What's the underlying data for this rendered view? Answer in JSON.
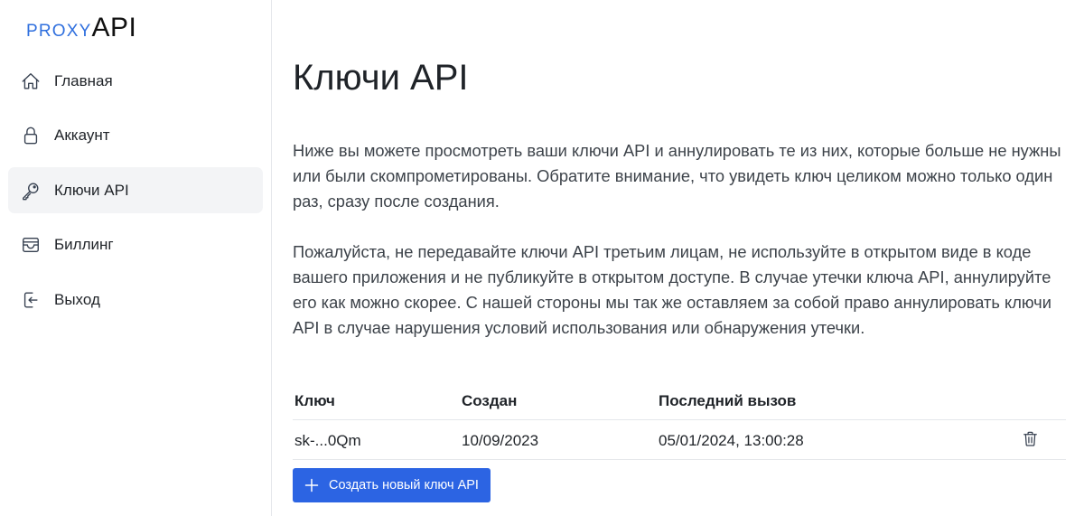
{
  "brand": {
    "logo_prefix": "PROXY",
    "logo_suffix": "API",
    "accent_color": "#2f6fde"
  },
  "sidebar": {
    "items": [
      {
        "label": "Главная",
        "icon": "home-icon",
        "active": false
      },
      {
        "label": "Аккаунт",
        "icon": "lock-icon",
        "active": false
      },
      {
        "label": "Ключи API",
        "icon": "key-icon",
        "active": true
      },
      {
        "label": "Биллинг",
        "icon": "archive-box-icon",
        "active": false
      },
      {
        "label": "Выход",
        "icon": "logout-icon",
        "active": false
      }
    ]
  },
  "main": {
    "title": "Ключи API",
    "paragraphs": [
      "Ниже вы можете просмотреть ваши ключи API и аннулировать те из них, которые больше не нужны или были скомпрометированы. Обратите внимание, что увидеть ключ целиком можно только один раз, сразу после создания.",
      "Пожалуйста, не передавайте ключи API третьим лицам, не используйте в открытом виде в коде вашего приложения и не публикуйте в открытом доступе. В случае утечки ключа API, аннулируйте его как можно скорее. С нашей стороны мы так же оставляем за собой право аннулировать ключи API в случае нарушения условий использования или обнаружения утечки."
    ],
    "table": {
      "columns": [
        "Ключ",
        "Создан",
        "Последний вызов"
      ],
      "rows": [
        {
          "key": "sk-...0Qm",
          "created": "10/09/2023",
          "last_call": "05/01/2024, 13:00:28",
          "action_icon": "trash-icon"
        }
      ]
    },
    "create_button": {
      "label": "Создать новый ключ API",
      "icon": "plus-icon",
      "color": "#2c64e3"
    }
  }
}
